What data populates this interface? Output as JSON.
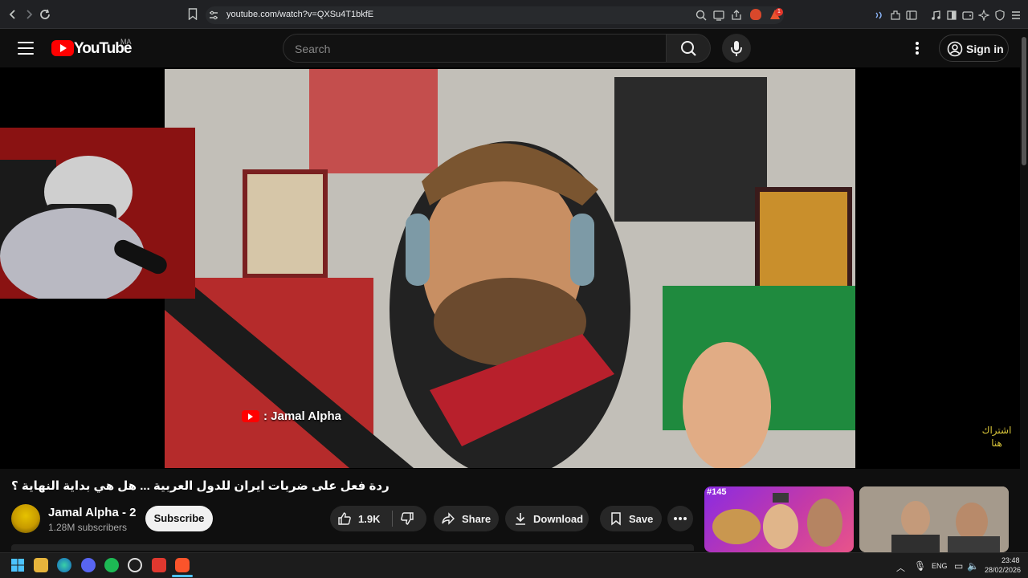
{
  "browser": {
    "url": "youtube.com/watch?v=QXSu4T1bkfE",
    "accent": "#202124",
    "ext_badge": "1"
  },
  "header": {
    "logo_text": "YouTube",
    "region": "MA",
    "search_placeholder": "Search",
    "signin_label": "Sign in"
  },
  "player": {
    "overlay_channel": ": Jamal Alpha",
    "subscribe_overlay": "اشتراك هنا"
  },
  "video": {
    "title": "ردة فعل على ضربات ايران للدول العربية ... هل هي بداية النهاية ؟",
    "channel_name": "Jamal Alpha - 2",
    "subscribers": "1.28M subscribers",
    "subscribe_label": "Subscribe",
    "likes": "1.9K",
    "share_label": "Share",
    "download_label": "Download",
    "save_label": "Save"
  },
  "recommendations": [
    {
      "tag": "#145",
      "icons": "thumbnail"
    },
    {
      "tag": "",
      "icons": "thumbnail"
    }
  ],
  "taskbar": {
    "lang": "ENG",
    "time": "23:48",
    "date": "28/02/2026"
  },
  "colors": {
    "yt_red": "#ff0000",
    "bg": "#0f0f0f",
    "overlay_yellow": "#d8c53a"
  }
}
